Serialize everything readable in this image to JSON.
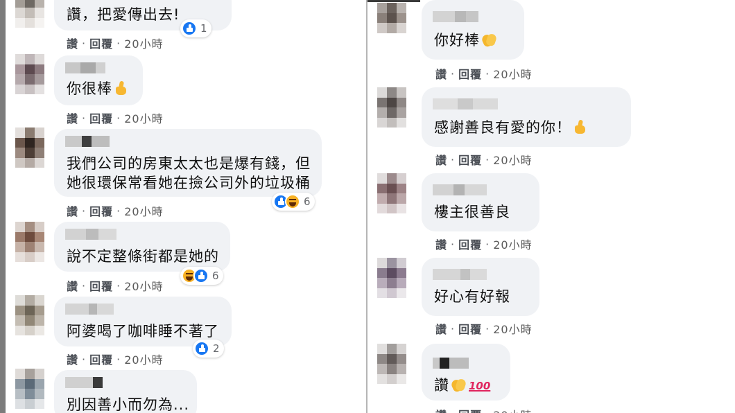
{
  "action_labels": {
    "like": "讚",
    "separator": "·",
    "reply": "回覆"
  },
  "colors": {
    "bubble": "#f0f2f5",
    "like_blue": "#1877f2",
    "haha_yellow": "#f7b125",
    "meta_gray": "#65676b"
  },
  "left_column": [
    {
      "text": "讚，把愛傳出去!",
      "time": "20小時",
      "reactions": {
        "types": [
          "like"
        ],
        "count": "1"
      }
    },
    {
      "text": "你很棒",
      "emoji": [
        "thumbs-up-icon"
      ],
      "time": "20小時"
    },
    {
      "lines": [
        "我們公司的房東太太也是爆有錢，但",
        "她很環保常看她在撿公司外的垃圾桶"
      ],
      "time": "20小時",
      "reactions": {
        "types": [
          "like",
          "haha"
        ],
        "count": "6"
      }
    },
    {
      "text": "說不定整條街都是她的",
      "time": "20小時",
      "reactions": {
        "types": [
          "haha",
          "like"
        ],
        "count": "6"
      }
    },
    {
      "text": "阿婆喝了咖啡睡不著了",
      "time": "20小時",
      "reactions": {
        "types": [
          "like"
        ],
        "count": "2"
      }
    },
    {
      "text": "別因善小而勿為..."
    }
  ],
  "right_column": [
    {
      "text": "你好棒",
      "emoji": [
        "clap-icon"
      ],
      "time": "20小時"
    },
    {
      "text": "感謝善良有愛的你！",
      "emoji": [
        "thumbs-up-icon"
      ],
      "time": "20小時"
    },
    {
      "text": "樓主很善良",
      "time": "20小時"
    },
    {
      "text": "好心有好報",
      "time": "20小時"
    },
    {
      "text": "讚",
      "emoji": [
        "clap-icon",
        "hundred-points-icon"
      ],
      "hundred_text": "100",
      "time": "20小時"
    }
  ]
}
